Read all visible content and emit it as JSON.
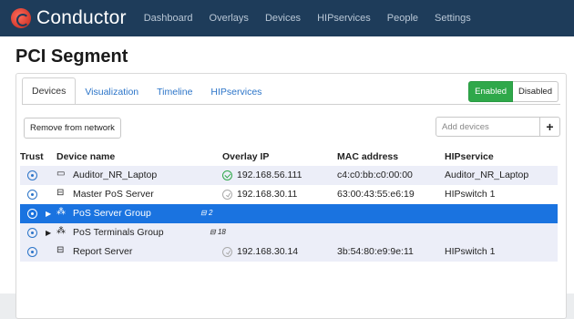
{
  "app": {
    "name": "Conductor"
  },
  "nav": [
    "Dashboard",
    "Overlays",
    "Devices",
    "HIPservices",
    "People",
    "Settings"
  ],
  "page_title": "PCI Segment",
  "tabs": [
    "Devices",
    "Visualization",
    "Timeline",
    "HIPservices"
  ],
  "toggle": {
    "enabled_label": "Enabled",
    "disabled_label": "Disabled"
  },
  "toolbar": {
    "remove_label": "Remove from network",
    "add_placeholder": "Add devices",
    "add_button": "+"
  },
  "table": {
    "headers": [
      "Trust",
      "Device name",
      "Overlay IP",
      "MAC address",
      "HIPservice"
    ],
    "rows": [
      {
        "name": "Auditor_NR_Laptop",
        "count": "",
        "ip": "192.168.56.111",
        "mac": "c4:c0:bb:c0:00:00",
        "hip": "Auditor_NR_Laptop"
      },
      {
        "name": "Master PoS Server",
        "count": "",
        "ip": "192.168.30.11",
        "mac": "63:00:43:55:e6:19",
        "hip": "HIPswitch 1"
      },
      {
        "name": "PoS Server Group",
        "count": "2",
        "ip": "",
        "mac": "",
        "hip": ""
      },
      {
        "name": "PoS Terminals Group",
        "count": "18",
        "ip": "",
        "mac": "",
        "hip": ""
      },
      {
        "name": "Report Server",
        "count": "",
        "ip": "192.168.30.14",
        "mac": "3b:54:80:e9:9e:11",
        "hip": "HIPswitch 1"
      }
    ]
  },
  "colors": {
    "topbar": "#1e3c5a",
    "accent": "#2b74c8",
    "selected_row": "#1a73e0",
    "enabled": "#2fa84a"
  }
}
